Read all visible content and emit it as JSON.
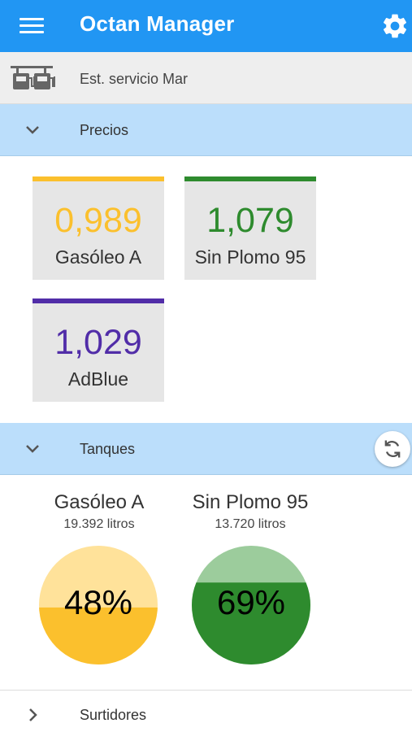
{
  "app": {
    "title": "Octan Manager"
  },
  "header": {
    "menu_icon": "menu-icon",
    "settings_icon": "gear-icon"
  },
  "station": {
    "name": "Est. servicio Mar",
    "icon": "gas-station-icon"
  },
  "prices_section": {
    "title": "Precios",
    "expanded": true,
    "products": [
      {
        "value": "0,989",
        "name": "Gasóleo A",
        "color": "#fbc02d"
      },
      {
        "value": "1,079",
        "name": "Sin Plomo 95",
        "color": "#2e8b2e"
      },
      {
        "value": "1,029",
        "name": "AdBlue",
        "color": "#512da8"
      }
    ]
  },
  "tanks_section": {
    "title": "Tanques",
    "expanded": true,
    "refresh_icon": "refresh-icon",
    "tanks": [
      {
        "name": "Gasóleo A",
        "liters": "19.392 litros",
        "percent_label": "48%",
        "level": 0.48,
        "fill_color": "#fbc02d",
        "empty_color": "#ffe29a"
      },
      {
        "name": "Sin Plomo 95",
        "liters": "13.720 litros",
        "percent_label": "69%",
        "level": 0.69,
        "fill_color": "#2e8b2e",
        "empty_color": "#9ccc9c"
      }
    ]
  },
  "pumps_section": {
    "title": "Surtidores",
    "expanded": false
  }
}
